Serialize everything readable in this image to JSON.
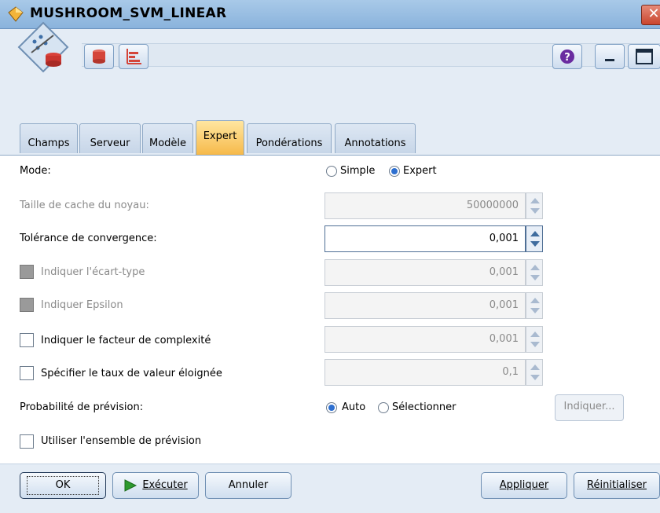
{
  "window": {
    "title": "MUSHROOM_SVM_LINEAR"
  },
  "tabs": [
    {
      "label": "Champs"
    },
    {
      "label": "Serveur"
    },
    {
      "label": "Modèle"
    },
    {
      "label": "Expert"
    },
    {
      "label": "Pondérations"
    },
    {
      "label": "Annotations"
    }
  ],
  "active_tab": "Expert",
  "form": {
    "mode": {
      "label": "Mode:",
      "options": [
        "Simple",
        "Expert"
      ],
      "selected": "Expert"
    },
    "cache": {
      "label": "Taille de cache du noyau:",
      "value": "50000000"
    },
    "tolerance": {
      "label": "Tolérance de convergence:",
      "value": "0,001"
    },
    "ecart_type": {
      "label": "Indiquer l'écart-type",
      "value": "0,001"
    },
    "epsilon": {
      "label": "Indiquer Epsilon",
      "value": "0,001"
    },
    "complexite": {
      "label": "Indiquer le facteur de complexité",
      "value": "0,001"
    },
    "valeur_eloignee": {
      "label": "Spécifier le taux de valeur éloignée",
      "value": "0,1"
    },
    "probabilite": {
      "label": "Probabilité de prévision:",
      "options": [
        "Auto",
        "Sélectionner"
      ],
      "selected": "Auto",
      "button": "Indiquer..."
    },
    "ensemble": {
      "label": "Utiliser l'ensemble de prévision"
    }
  },
  "footer": {
    "ok": "OK",
    "run": "Exécuter",
    "cancel": "Annuler",
    "apply": "Appliquer",
    "reset": "Réinitialiser"
  },
  "colors": {
    "active_tab": "#f6b94a",
    "titlebar": "#a8c9e8",
    "radio_on": "#2d6fd0"
  },
  "icons": [
    "app-icon",
    "node-icon",
    "database-icon",
    "chart-icon",
    "help-icon",
    "minimize-icon",
    "maximize-icon",
    "close-icon",
    "run-icon"
  ]
}
